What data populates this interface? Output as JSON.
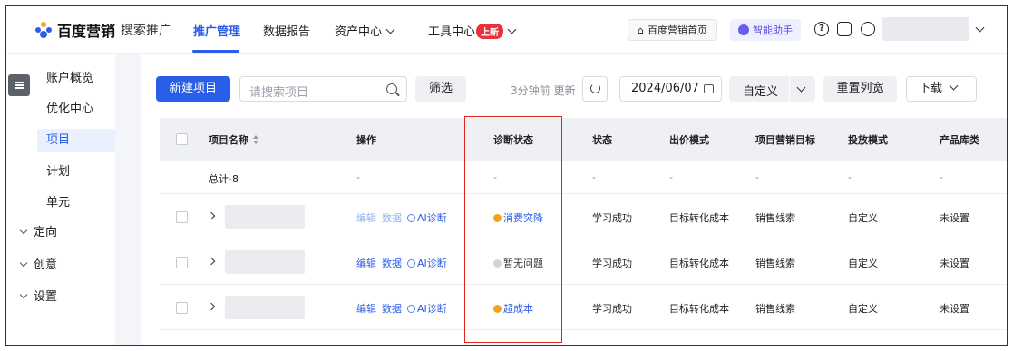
{
  "topnav": {
    "brand": "百度营销",
    "product": "搜索推广",
    "tabs": [
      {
        "label": "推广管理",
        "active": true
      },
      {
        "label": "数据报告"
      },
      {
        "label": "资产中心"
      },
      {
        "label": "工具中心",
        "badge": "上新"
      }
    ],
    "home_label": "百度营销首页",
    "assistant_label": "智能助手"
  },
  "sidebar": {
    "items": [
      {
        "label": "账户概览"
      },
      {
        "label": "优化中心"
      },
      {
        "label": "项目",
        "active": true
      },
      {
        "label": "计划"
      },
      {
        "label": "单元"
      },
      {
        "label": "定向",
        "collapsible": true
      },
      {
        "label": "创意",
        "collapsible": true
      },
      {
        "label": "设置",
        "collapsible": true
      }
    ]
  },
  "toolbar": {
    "new_project": "新建项目",
    "search_placeholder": "请搜索项目",
    "filter": "筛选",
    "updated": "3分钟前 更新",
    "date": "2024/06/07",
    "custom": "自定义",
    "reset_columns": "重置列宽",
    "download": "下载"
  },
  "table": {
    "columns": [
      "项目名称",
      "操作",
      "诊断状态",
      "状态",
      "出价模式",
      "项目营销目标",
      "投放模式",
      "产品库类"
    ],
    "total_row": {
      "name": "总计-8",
      "dash": "-"
    },
    "op_labels": {
      "edit": "编辑",
      "data": "数据",
      "ai": "AI诊断"
    },
    "rows": [
      {
        "diagnosis": "消费突降",
        "diag_level": "warn",
        "status": "学习成功",
        "bid": "目标转化成本",
        "goal": "销售线索",
        "mode": "自定义",
        "catalog": "未设置"
      },
      {
        "diagnosis": "暂无问题",
        "diag_level": "ok",
        "status": "学习成功",
        "bid": "目标转化成本",
        "goal": "销售线索",
        "mode": "自定义",
        "catalog": "未设置"
      },
      {
        "diagnosis": "超成本",
        "diag_level": "warn",
        "status": "学习成功",
        "bid": "目标转化成本",
        "goal": "销售线索",
        "mode": "自定义",
        "catalog": "未设置"
      }
    ]
  },
  "colors": {
    "primary": "#2a5de8",
    "highlight_box": "#e0241b",
    "warning": "#f0a31f",
    "badge": "#e8313a"
  }
}
